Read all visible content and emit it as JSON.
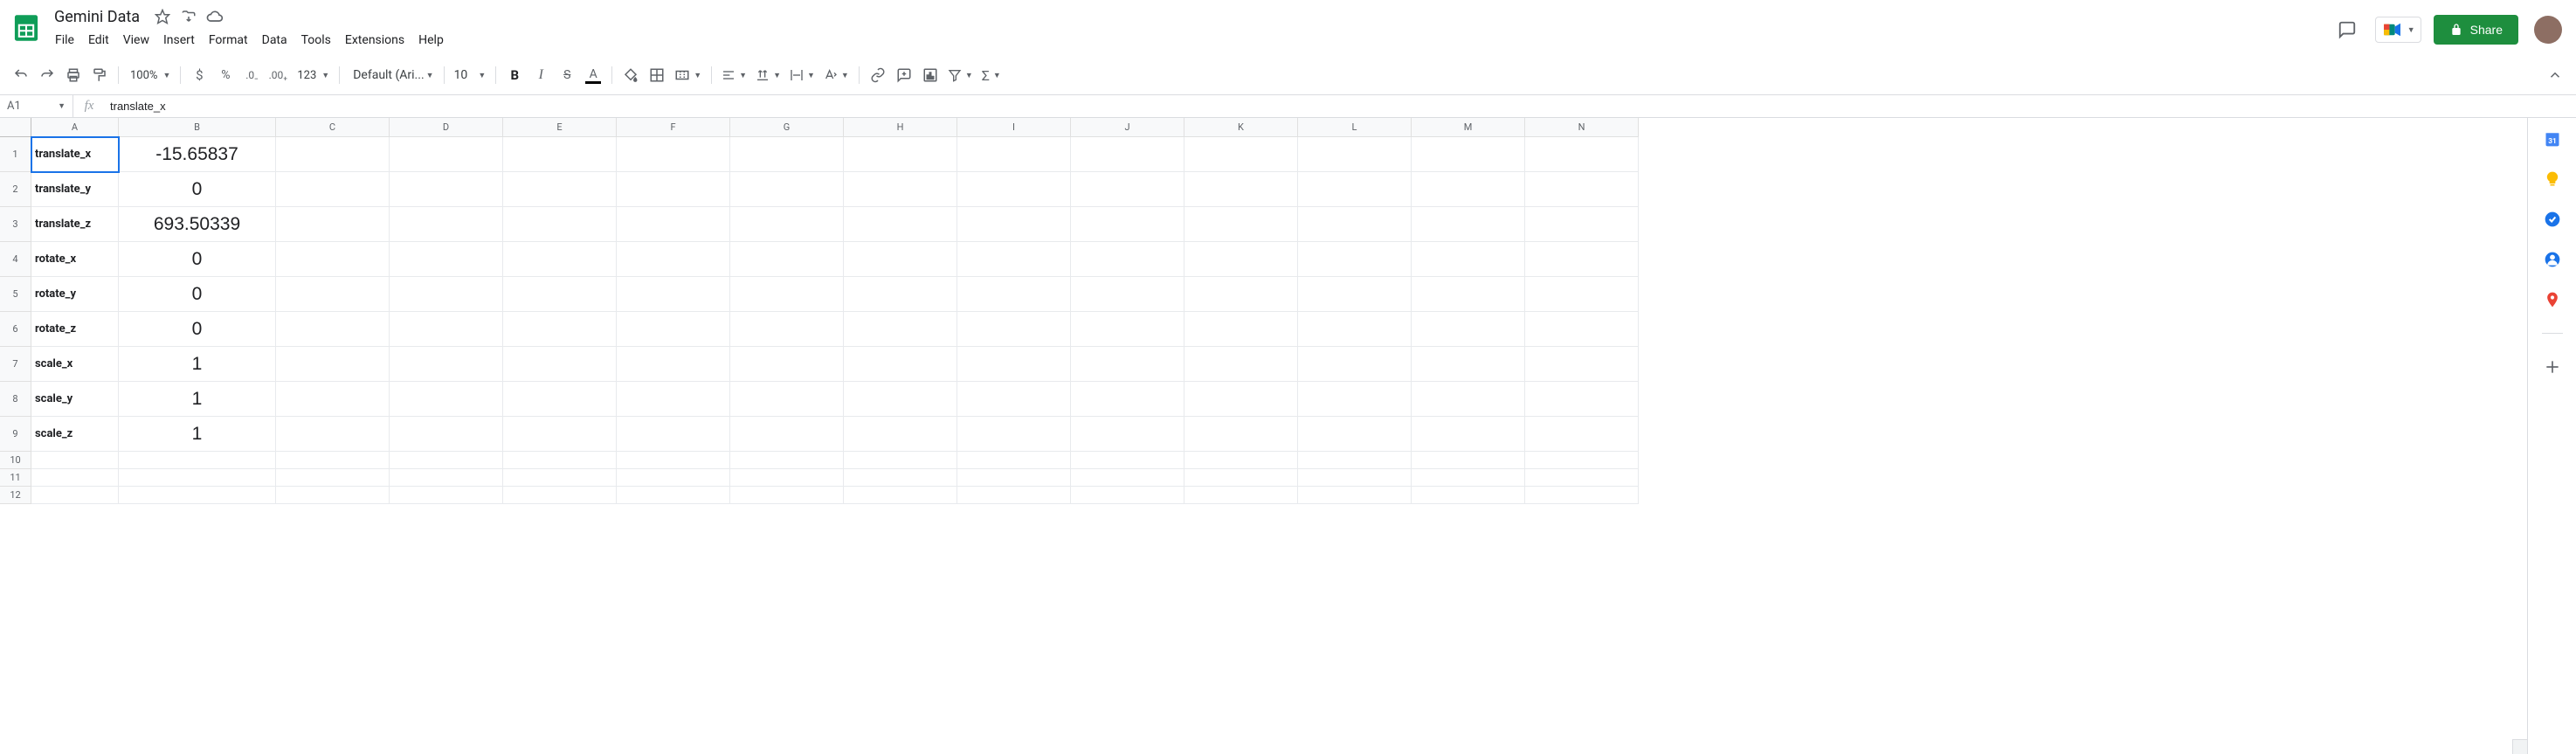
{
  "doc": {
    "title": "Gemini Data"
  },
  "menubar": [
    "File",
    "Edit",
    "View",
    "Insert",
    "Format",
    "Data",
    "Tools",
    "Extensions",
    "Help"
  ],
  "toolbar": {
    "zoom": "100%",
    "font": "Default (Ari...",
    "font_size": "10",
    "more_formats": "123"
  },
  "share": {
    "label": "Share"
  },
  "name_box": "A1",
  "formula": "translate_x",
  "columns": [
    "A",
    "B",
    "C",
    "D",
    "E",
    "F",
    "G",
    "H",
    "I",
    "J",
    "K",
    "L",
    "M",
    "N"
  ],
  "rows": [
    {
      "num": 1,
      "height": "tall",
      "a": "translate_x",
      "b": "-15.65837"
    },
    {
      "num": 2,
      "height": "tall",
      "a": "translate_y",
      "b": "0"
    },
    {
      "num": 3,
      "height": "tall",
      "a": "translate_z",
      "b": "693.50339"
    },
    {
      "num": 4,
      "height": "tall",
      "a": "rotate_x",
      "b": "0"
    },
    {
      "num": 5,
      "height": "tall",
      "a": "rotate_y",
      "b": "0"
    },
    {
      "num": 6,
      "height": "tall",
      "a": "rotate_z",
      "b": "0"
    },
    {
      "num": 7,
      "height": "tall",
      "a": "scale_x",
      "b": "1"
    },
    {
      "num": 8,
      "height": "tall",
      "a": "scale_y",
      "b": "1"
    },
    {
      "num": 9,
      "height": "tall",
      "a": "scale_z",
      "b": "1"
    },
    {
      "num": 10,
      "height": "short",
      "a": "",
      "b": ""
    },
    {
      "num": 11,
      "height": "short",
      "a": "",
      "b": ""
    },
    {
      "num": 12,
      "height": "short",
      "a": "",
      "b": ""
    }
  ],
  "selected_cell": "A1",
  "colors": {
    "brand_green": "#1e8e3e",
    "selection_blue": "#1a73e8"
  }
}
